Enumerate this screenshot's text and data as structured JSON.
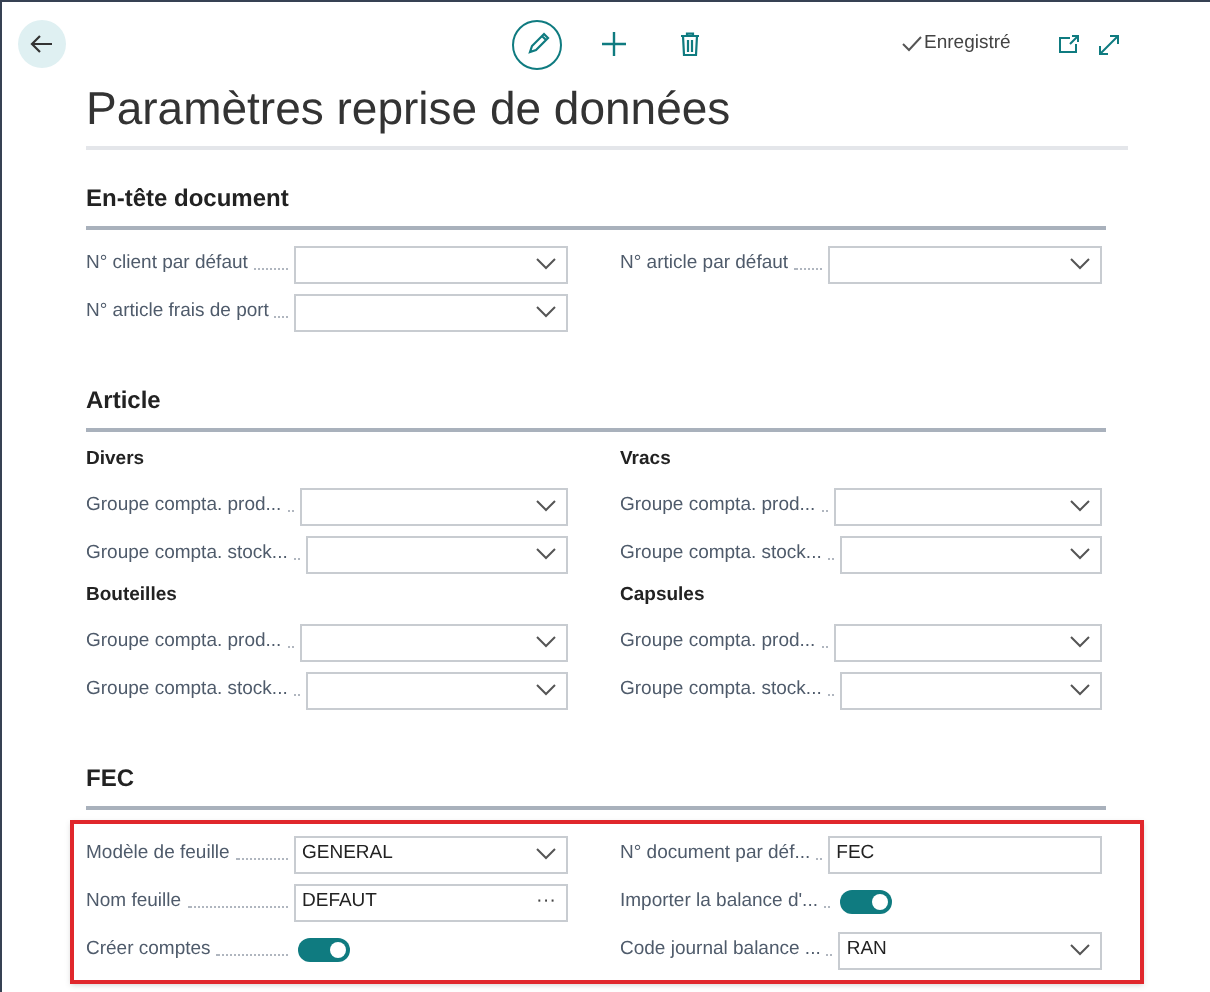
{
  "toolbar": {
    "status": "Enregistré"
  },
  "title": "Paramètres reprise de données",
  "sections": [
    {
      "heading": "En-tête document",
      "highlighted": false,
      "groups": [
        {
          "columns": [
            [
              {
                "kind": "dropdown",
                "label": "N° client par défaut"
              },
              {
                "kind": "dropdown",
                "label": "N° article frais de port"
              }
            ],
            [
              {
                "kind": "dropdown",
                "label": "N° article par défaut"
              }
            ]
          ]
        }
      ]
    },
    {
      "heading": "Article",
      "highlighted": false,
      "groups": [
        {
          "columns": [
            [
              {
                "kind": "subheading",
                "label": "Divers"
              },
              {
                "kind": "dropdown",
                "label": "Groupe compta. prod..."
              },
              {
                "kind": "dropdown",
                "label": "Groupe compta. stock..."
              }
            ],
            [
              {
                "kind": "subheading",
                "label": "Vracs"
              },
              {
                "kind": "dropdown",
                "label": "Groupe compta. prod..."
              },
              {
                "kind": "dropdown",
                "label": "Groupe compta. stock..."
              }
            ]
          ]
        },
        {
          "columns": [
            [
              {
                "kind": "subheading",
                "label": "Bouteilles"
              },
              {
                "kind": "dropdown",
                "label": "Groupe compta. prod..."
              },
              {
                "kind": "dropdown",
                "label": "Groupe compta. stock..."
              }
            ],
            [
              {
                "kind": "subheading",
                "label": "Capsules"
              },
              {
                "kind": "dropdown",
                "label": "Groupe compta. prod..."
              },
              {
                "kind": "dropdown",
                "label": "Groupe compta. stock..."
              }
            ]
          ]
        }
      ]
    },
    {
      "heading": "FEC",
      "highlighted": true,
      "groups": [
        {
          "columns": [
            [
              {
                "kind": "dropdown",
                "label": "Modèle de feuille",
                "value": "GENERAL"
              },
              {
                "kind": "lookup",
                "label": "Nom feuille",
                "value": "DEFAUT",
                "button": "···"
              },
              {
                "kind": "toggle",
                "label": "Créer comptes",
                "on": true
              }
            ],
            [
              {
                "kind": "text",
                "label": "N° document par déf...",
                "value": "FEC"
              },
              {
                "kind": "toggle",
                "label": "Importer la balance d'...",
                "on": true
              },
              {
                "kind": "dropdown",
                "label": "Code journal balance ...",
                "value": "RAN"
              }
            ]
          ]
        }
      ]
    }
  ]
}
